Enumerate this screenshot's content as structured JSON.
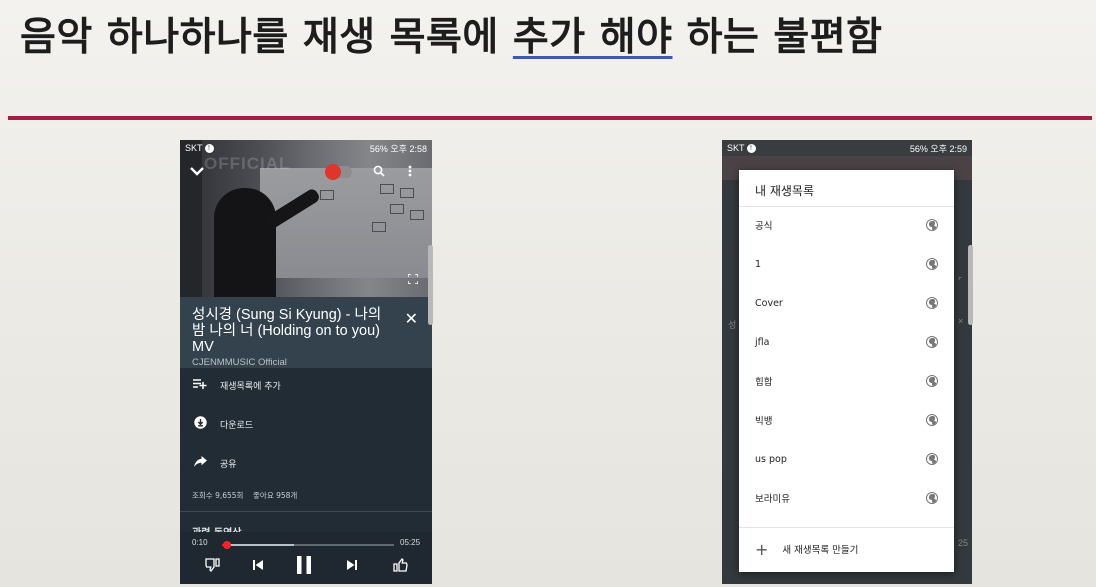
{
  "slide": {
    "title_lead": "음악 하나하나를 재생 목록에",
    "title_emph": "추가 해야",
    "title_tail": "하는 불편함"
  },
  "colors": {
    "rule": "#a51c46",
    "underline": "#3b5aa8",
    "progress": "#ff1f1f"
  },
  "phone1": {
    "status": {
      "carrier": "SKT",
      "right": "56% 오후 2:58"
    },
    "video": {
      "watermark": "OFFICIAL",
      "icons": [
        "chevron-down-icon",
        "headphones-toggle",
        "search-icon",
        "more-vert-icon",
        "fullscreen-icon"
      ]
    },
    "info": {
      "title": "성시경 (Sung Si Kyung) - 나의 밤 나의 너 (Holding on to you) MV",
      "channel": "CJENMMUSIC Official",
      "close": "✕"
    },
    "menu": [
      {
        "icon": "playlist-add-icon",
        "label": "재생목록에 추가"
      },
      {
        "icon": "download-icon",
        "label": "다운로드"
      },
      {
        "icon": "share-icon",
        "label": "공유"
      }
    ],
    "stats": {
      "views": "조회수 9,655회",
      "likes": "좋아요 958개"
    },
    "related_label": "관련 동영상",
    "player": {
      "current_time": "0:10",
      "duration": "05:25",
      "progress_fraction": 0.03,
      "buffered_fraction": 0.42
    }
  },
  "phone2": {
    "status": {
      "carrier": "SKT",
      "right": "56% 오후 2:59"
    },
    "dialog": {
      "title": "내 재생목록",
      "playlists": [
        "공식",
        "1",
        "Cover",
        "jfla",
        "힙합",
        "빅뱅",
        "us pop",
        "보라미유"
      ],
      "new_playlist": "새 재생목록 만들기",
      "plus": "+"
    }
  }
}
